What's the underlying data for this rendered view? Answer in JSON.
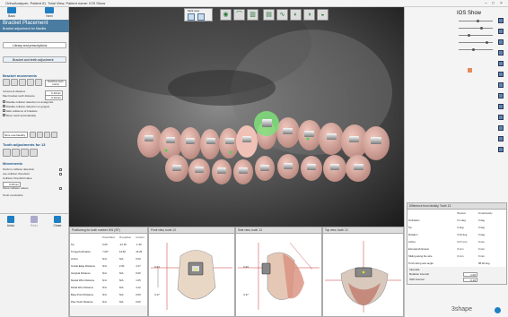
{
  "window": {
    "title": "OrthoAnalyzer, Patient ID, Total View, Patient name: IOS Show"
  },
  "nav": {
    "back": "Back",
    "next": "Next"
  },
  "left": {
    "header": "Bracket Placement",
    "subheader": "Bracket adjustment for Maxilla",
    "library_btn": "Library and prescriptions",
    "bracket_adjust_btn": "Bracket and teeth adjustment",
    "section_movements": "Bracket movements",
    "increment_label": "Increment distance",
    "increment_value": "0.10mm",
    "rotation_label": "Max bracket tooth distance",
    "rotation_value": "0.10mm",
    "distribute_btn": "Distribute teeth evenly",
    "checks": [
      "Disable collision detection to antagonist",
      "Disable collision detection to gingiva",
      "Hide collisions of brackets",
      "Move teeth automatically"
    ],
    "more_btn": "More over/standby",
    "section_teeth": "Tooth adjustments for 13",
    "section_movements2": "Movements",
    "perform_label": "Perform collision detection",
    "use_threshold_label": "use collision threshold",
    "threshold_label": "Collision threshold value",
    "threshold_value": "0.00mm",
    "show_label": "Show collision values",
    "tooth_label": "Tooth constraints"
  },
  "bottom_nav": {
    "undo": "Undo",
    "redo": "Redo",
    "close": "Close"
  },
  "toolbar": {
    "label": "Multi view",
    "icons": [
      "occlusal-view-icon",
      "jaw-open-icon",
      "teeth-icon",
      "brackets-icon",
      "wire-icon",
      "frontal-view-icon",
      "right-view-icon",
      "left-view-icon",
      "settings-icon"
    ]
  },
  "right": {
    "title": "IOS Show",
    "diff_title": "Difference from ideality, Tooth 13",
    "diff_cols": [
      "",
      "Bracket",
      "Final/ideality"
    ],
    "diff_rows": [
      [
        "Inclination",
        "0.1 deg",
        "0 deg"
      ],
      [
        "Tip",
        "0 deg",
        "0 deg"
      ],
      [
        "Rotation",
        "6.34 deg",
        "0 deg"
      ],
      [
        "In/Out",
        "0.17 mm",
        "0 mm"
      ],
      [
        "Extrusion/Intrusion",
        "0 mm",
        "0 mm"
      ],
      [
        "Sliding along the wire",
        "0 mm",
        "0 mm"
      ],
      [
        "Torch along axis angle",
        "",
        "58.40 deg"
      ]
    ],
    "intervals_label": "Intervals",
    "rotation_interval_label": "Rotation interval",
    "rotation_interval_value": "1.00",
    "shift_interval_label": "Shift interval",
    "shift_interval_value": "0.10"
  },
  "table_panel": {
    "title": "Positioning for tooth number WI1 (SP)",
    "cols": [
      "",
      "Prescribed",
      "IS position",
      "Current"
    ],
    "rows": [
      [
        "Tip",
        "0.00",
        "-12.30",
        "-1.30"
      ],
      [
        "Torque/Inclination",
        "7.00*",
        "13.60",
        "16.26"
      ],
      [
        "In/Out",
        "N/A",
        "N/A",
        "0.00"
      ],
      [
        "Incisal Edge Distance",
        "N/A",
        "2.90",
        "4.17"
      ],
      [
        "Gingival Distance",
        "N/A",
        "N/A",
        "0.00"
      ],
      [
        "Mesial Wire Distance",
        "N/A",
        "N/A",
        "1.25"
      ],
      [
        "Distal Wire Distance",
        "N/A",
        "N/A",
        "4.12"
      ],
      [
        "Base Point Distance",
        "N/A",
        "N/A",
        "0.00"
      ],
      [
        "Plus Tooth Distance",
        "N/A",
        "N/A",
        "0.00"
      ]
    ]
  },
  "views": {
    "front": {
      "title": "Front view, tooth 13",
      "upper": "3.43",
      "lower": "4.17"
    },
    "side": {
      "title": "Side view, tooth 13",
      "upper": "3.43",
      "lower": "4.17"
    },
    "top": {
      "title": "Top view, tooth 13"
    }
  },
  "brand": {
    "logo": "3shape",
    "accent": "#1f7fc2",
    "header_blue": "#4a7ba0"
  }
}
